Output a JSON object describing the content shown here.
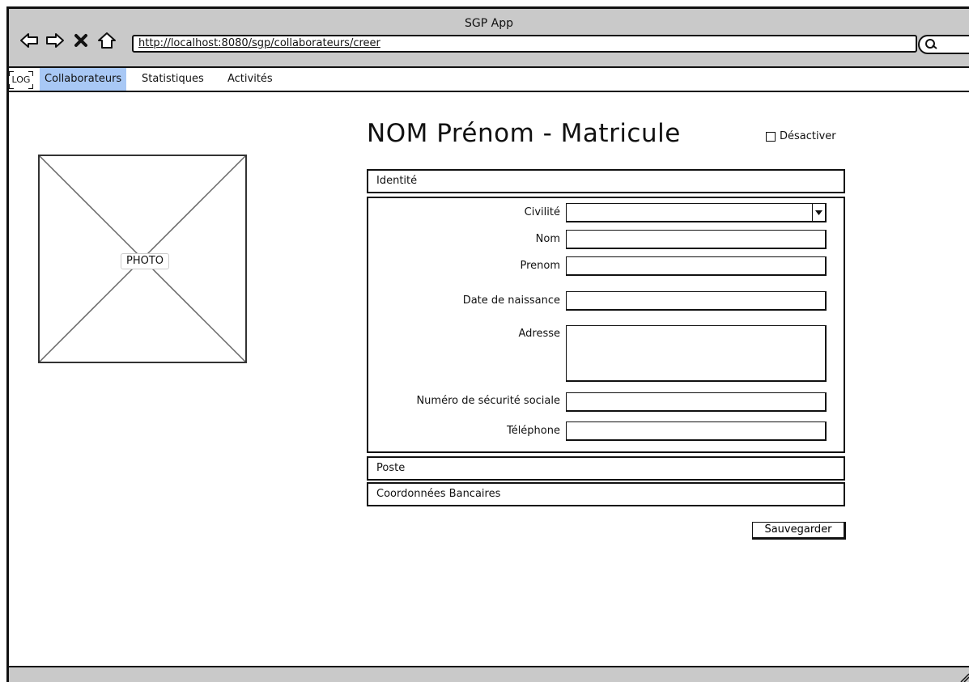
{
  "window": {
    "title": "SGP App"
  },
  "browser": {
    "url": "http://localhost:8080/sgp/collaborateurs/creer"
  },
  "menubar": {
    "logo": "LOG",
    "items": [
      {
        "label": "Collaborateurs",
        "active": true
      },
      {
        "label": "Statistiques",
        "active": false
      },
      {
        "label": "Activités",
        "active": false
      }
    ]
  },
  "photo": {
    "label": "PHOTO"
  },
  "header": {
    "title": "NOM Prénom - Matricule",
    "deactivate_label": "Désactiver",
    "deactivate_checked": false
  },
  "sections": {
    "identity": "Identité",
    "poste": "Poste",
    "bank": "Coordonnées Bancaires"
  },
  "form": {
    "civilite": {
      "label": "Civilité",
      "value": ""
    },
    "nom": {
      "label": "Nom",
      "value": ""
    },
    "prenom": {
      "label": "Prenom",
      "value": ""
    },
    "naissance": {
      "label": "Date de naissance",
      "value": ""
    },
    "adresse": {
      "label": "Adresse",
      "value": ""
    },
    "secu": {
      "label": "Numéro de sécurité sociale",
      "value": ""
    },
    "telephone": {
      "label": "Téléphone",
      "value": ""
    }
  },
  "actions": {
    "save_label": "Sauvegarder"
  },
  "colors": {
    "active_menu": "#a8c8f5",
    "chrome": "#c9c9c9"
  }
}
